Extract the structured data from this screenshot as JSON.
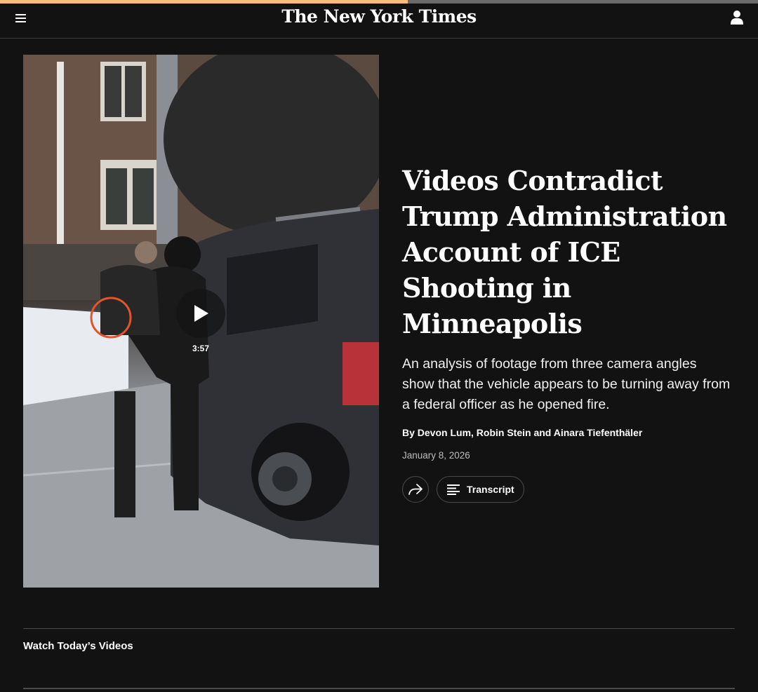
{
  "reading_progress": 0.538,
  "header": {
    "menu_icon": "hamburger-menu-icon",
    "logo": "The New York Times",
    "user_icon": "person-icon"
  },
  "video": {
    "duration": "3:57",
    "play_icon": "play-icon"
  },
  "article": {
    "headline": "Videos Contradict Trump Administration Account of ICE Shooting in Minneapolis",
    "summary": "An analysis of footage from three camera angles show that the vehicle appears to be turning away from a federal officer as he opened fire.",
    "byline": "By Devon Lum, Robin Stein and Ainara Tiefenthäler",
    "date": "January 8, 2026",
    "share_icon": "share-arrow-icon",
    "transcript_label": "Transcript",
    "transcript_icon": "text-lines-icon"
  },
  "section": {
    "label": "Watch Today’s Videos"
  },
  "colors": {
    "background": "#121212",
    "progress_fill": "#f7c07a",
    "highlight_circle": "#e0552a"
  }
}
